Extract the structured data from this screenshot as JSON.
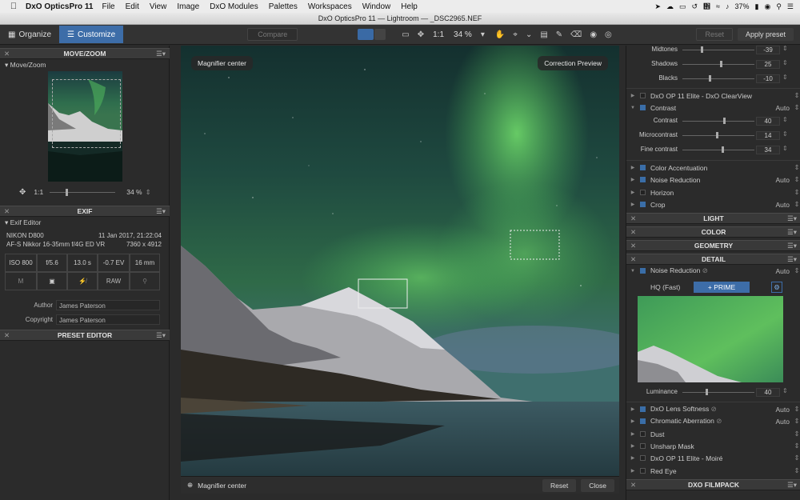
{
  "menubar": {
    "app": "DxO OpticsPro 11",
    "items": [
      "File",
      "Edit",
      "View",
      "Image",
      "DxO Modules",
      "Palettes",
      "Workspaces",
      "Window",
      "Help"
    ],
    "battery": "37%"
  },
  "window": {
    "title": "DxO OpticsPro 11 — Lightroom — _DSC2965.NEF"
  },
  "toolbar": {
    "organize": "Organize",
    "customize": "Customize",
    "compare": "Compare",
    "one_to_one": "1:1",
    "zoom": "34 %",
    "reset": "Reset",
    "apply_preset": "Apply preset"
  },
  "left": {
    "movezoom": {
      "header": "MOVE/ZOOM",
      "sub": "Move/Zoom",
      "scale": "1:1",
      "zoom": "34 %"
    },
    "exif": {
      "header": "EXIF",
      "sub": "Exif Editor",
      "camera": "NIKON D800",
      "date": "11 Jan 2017, 21:22:04",
      "lens": "AF-S Nikkor 16-35mm f/4G ED VR",
      "dimensions": "7360 x 4912",
      "iso": "ISO 800",
      "aperture": "f/5.6",
      "shutter": "13.0 s",
      "ev": "-0.7 EV",
      "focal": "16 mm",
      "mode": "M",
      "format": "RAW",
      "author_label": "Author",
      "author": "James Paterson",
      "copyright_label": "Copyright",
      "copyright": "James Paterson"
    },
    "preset_editor": {
      "header": "PRESET EDITOR"
    }
  },
  "viewer": {
    "magnifier_label": "Magnifier center",
    "correction_label": "Correction Preview",
    "bottom_magnifier": "Magnifier center",
    "reset": "Reset",
    "close": "Close"
  },
  "right": {
    "midtones": {
      "label": "Midtones",
      "value": "-39"
    },
    "shadows": {
      "label": "Shadows",
      "value": "25"
    },
    "blacks": {
      "label": "Blacks",
      "value": "-10"
    },
    "clearview": "DxO OP 11 Elite - DxO ClearView",
    "contrast": {
      "label": "Contrast",
      "auto": "Auto",
      "contrast_label": "Contrast",
      "contrast_value": "40",
      "micro_label": "Microcontrast",
      "micro_value": "14",
      "fine_label": "Fine contrast",
      "fine_value": "34"
    },
    "color_accent": "Color Accentuation",
    "noise_reduction": {
      "label": "Noise Reduction",
      "auto": "Auto"
    },
    "horizon": "Horizon",
    "crop": {
      "label": "Crop",
      "auto": "Auto"
    },
    "sections": [
      "LIGHT",
      "COLOR",
      "GEOMETRY",
      "DETAIL"
    ],
    "detail_nr": {
      "label": "Noise Reduction",
      "auto": "Auto",
      "hq": "HQ (Fast)",
      "prime": "+ PRIME",
      "luminance_label": "Luminance",
      "luminance_value": "40"
    },
    "lens_softness": {
      "label": "DxO Lens Softness",
      "auto": "Auto"
    },
    "chromatic": {
      "label": "Chromatic Aberration",
      "auto": "Auto"
    },
    "dust": "Dust",
    "unsharp": "Unsharp Mask",
    "moire": "DxO OP 11 Elite - Moiré",
    "redeye": "Red Eye",
    "filmpack": "DXO FILMPACK"
  },
  "colors": {
    "accent": "#3d6da8",
    "toolbar_bg": "#333333",
    "panel_bg": "#2b2b2b"
  }
}
